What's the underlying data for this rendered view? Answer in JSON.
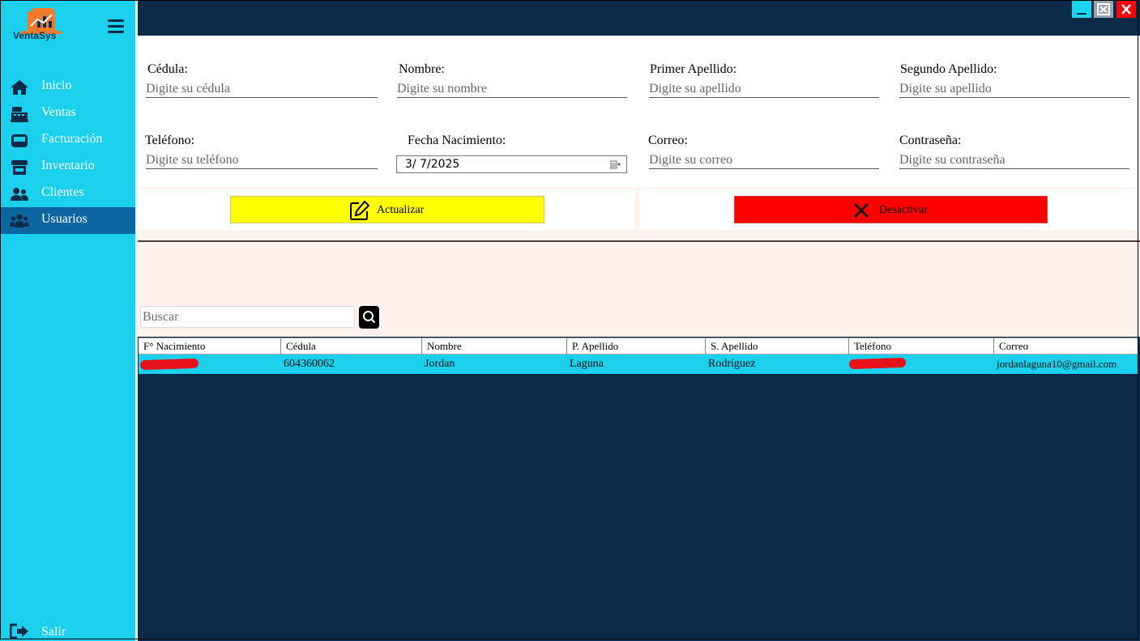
{
  "app": {
    "name": "VentaSys"
  },
  "sidebar": {
    "items": [
      {
        "label": "Inicio",
        "icon": "home-icon"
      },
      {
        "label": "Ventas",
        "icon": "cash-register-icon"
      },
      {
        "label": "Facturación",
        "icon": "inbox-icon"
      },
      {
        "label": "Inventario",
        "icon": "store-icon"
      },
      {
        "label": "Clientes",
        "icon": "users-icon"
      },
      {
        "label": "Usuarios",
        "icon": "group-icon",
        "active": true
      }
    ],
    "logout": {
      "label": "Salir",
      "icon": "sign-out-icon"
    }
  },
  "form": {
    "cedula": {
      "label": "Cédula:",
      "placeholder": "Digite su cédula"
    },
    "nombre": {
      "label": "Nombre:",
      "placeholder": "Digite su nombre"
    },
    "primer_apellido": {
      "label": "Primer Apellido:",
      "placeholder": "Digite su apellido"
    },
    "segundo_apellido": {
      "label": "Segundo Apellido:",
      "placeholder": "Digite su apellido"
    },
    "telefono": {
      "label": "Teléfono:",
      "placeholder": "Digite su teléfono"
    },
    "fecha_nacimiento": {
      "label": "Fecha Nacimiento:",
      "value": "3/  7/2025"
    },
    "correo": {
      "label": "Correo:",
      "placeholder": "Digite su correo"
    },
    "contrasena": {
      "label": "Contraseña:",
      "placeholder": "Digite su contraseña"
    }
  },
  "actions": {
    "update": {
      "label": "Actualizar",
      "color": "#ffff00"
    },
    "deactivate": {
      "label": "Desactivar",
      "color": "#ff0000"
    }
  },
  "search": {
    "placeholder": "Buscar"
  },
  "table": {
    "columns": [
      "F° Nacimiento",
      "Cédula",
      "Nombre",
      "P. Apellido",
      "S. Apellido",
      "Teléfono",
      "Correo"
    ],
    "rows": [
      {
        "fecha": "",
        "cedula": "604360062",
        "nombre": "Jordan",
        "p_apellido": "Laguna",
        "s_apellido": "Rodríguez",
        "telefono": "",
        "correo": "jordanlaguna10@gmail.com"
      }
    ]
  },
  "colors": {
    "sidebar": "#1ad0ec",
    "active_item": "#0c67a1",
    "dark_bg": "#0c2b48",
    "selected_row": "#1ad0ec"
  }
}
